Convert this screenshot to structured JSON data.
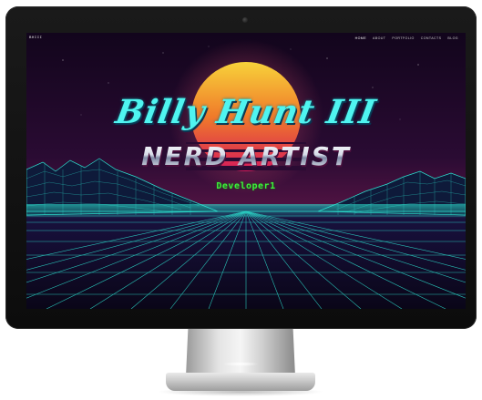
{
  "site": {
    "logo": "BHIII",
    "nav": {
      "items": [
        {
          "label": "HOME",
          "active": true
        },
        {
          "label": "ABOUT",
          "active": false
        },
        {
          "label": "PORTFOLIO",
          "active": false
        },
        {
          "label": "CONTACTS",
          "active": false
        },
        {
          "label": "BLOG",
          "active": false
        }
      ]
    },
    "hero": {
      "script_title": "Billy Hunt III",
      "main_title": "NERD ARTIST",
      "subtitle": "Developer1"
    }
  },
  "colors": {
    "sky_top": "#14061e",
    "sky_bottom": "#4a1140",
    "sun_top": "#f7d23a",
    "sun_bottom": "#e0245e",
    "grid": "#2de2d0",
    "script_title": "#4ff4f0",
    "subtitle": "#3cf23a"
  },
  "device": {
    "type": "desktop-monitor",
    "bezel_color": "#111111",
    "stand_color": "#cccccc"
  }
}
